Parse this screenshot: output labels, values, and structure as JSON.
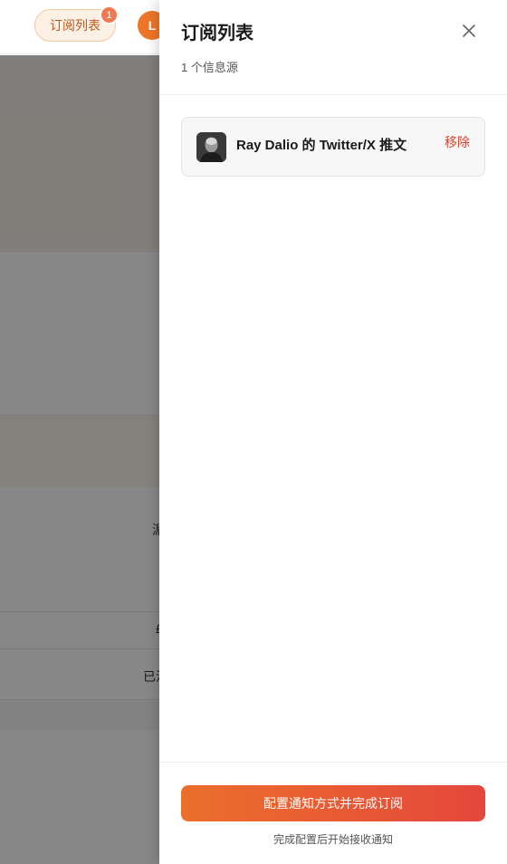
{
  "header": {
    "subscription_pill_label": "订阅列表",
    "subscription_badge_count": "1",
    "avatar_initial": "L"
  },
  "background_partial_text": {
    "row_a": "湄",
    "row_b": "£",
    "row_c": "已沅"
  },
  "drawer": {
    "title": "订阅列表",
    "subtitle": "1 个信息源",
    "items": [
      {
        "name": "Ray Dalio 的 Twitter/X 推文",
        "remove_label": "移除",
        "avatar_icon": "person-photo-icon"
      }
    ],
    "primary_button_label": "配置通知方式并完成订阅",
    "footer_hint": "完成配置后开始接收通知"
  },
  "colors": {
    "accent": "#ec6f2b",
    "danger": "#d8432b",
    "badge": "#ee7a52"
  }
}
